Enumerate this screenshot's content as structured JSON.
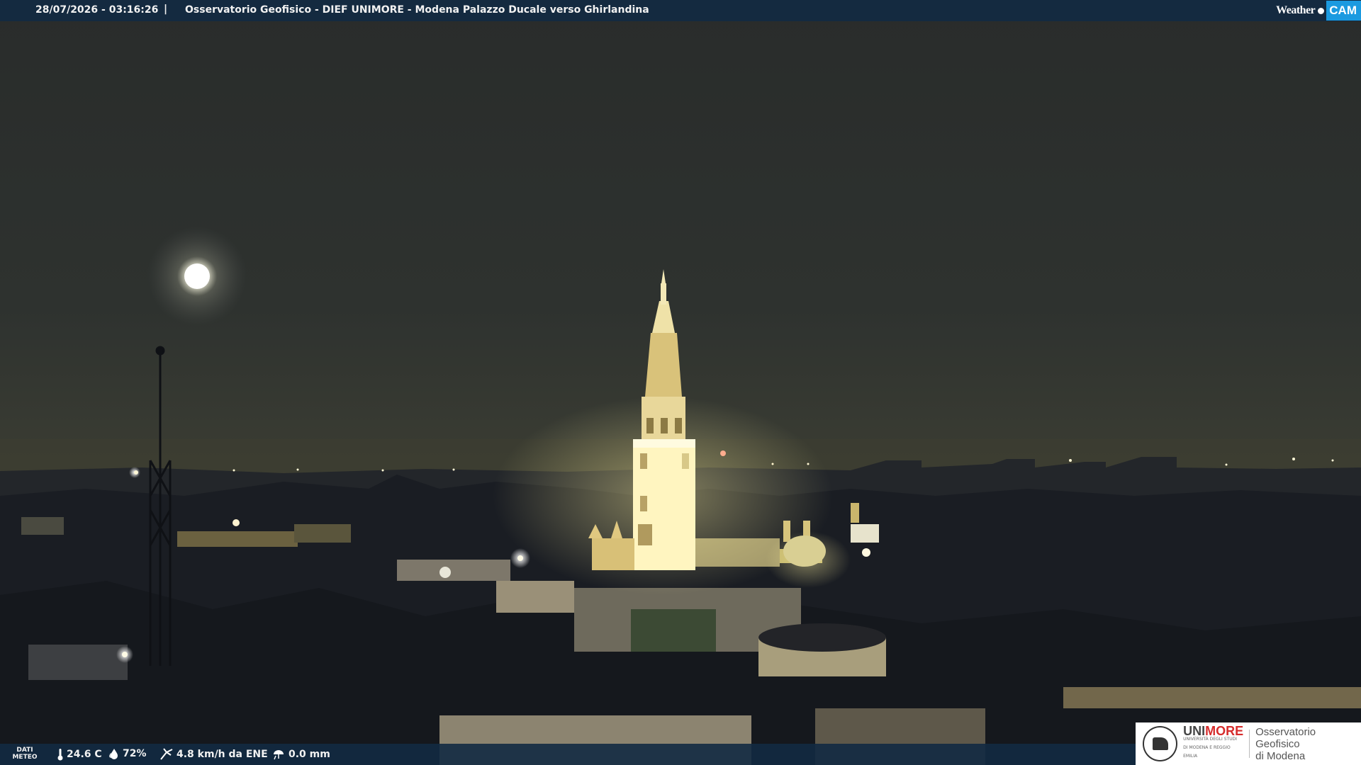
{
  "header": {
    "timestamp": "28/07/2026 - 03:16:26",
    "separator": "|",
    "caption": "Osservatorio Geofisico - DIEF UNIMORE - Modena Palazzo Ducale verso Ghirlandina",
    "brand_text": "Weather",
    "brand_badge": "CAM"
  },
  "weather": {
    "label": "DATI METEO",
    "temperature": "24.6 C",
    "humidity": "72%",
    "wind": "4.8 km/h da ENE",
    "rain": "0.0 mm",
    "icons": [
      "thermometer-icon",
      "droplet-icon",
      "wind-icon",
      "rain-icon"
    ]
  },
  "logo": {
    "uni_prefix": "UNI",
    "uni_suffix": "MORE",
    "uni_sub": "UNIVERSITÀ DEGLI STUDI DI MODENA E REGGIO EMILIA",
    "observatory_line1": "Osservatorio Geofisico",
    "observatory_line2": "di Modena"
  },
  "colors": {
    "bar": "#122a42",
    "brand_badge": "#1b9ae0",
    "tower_light": "#fff5c0",
    "accent_red": "#d62c2c"
  }
}
